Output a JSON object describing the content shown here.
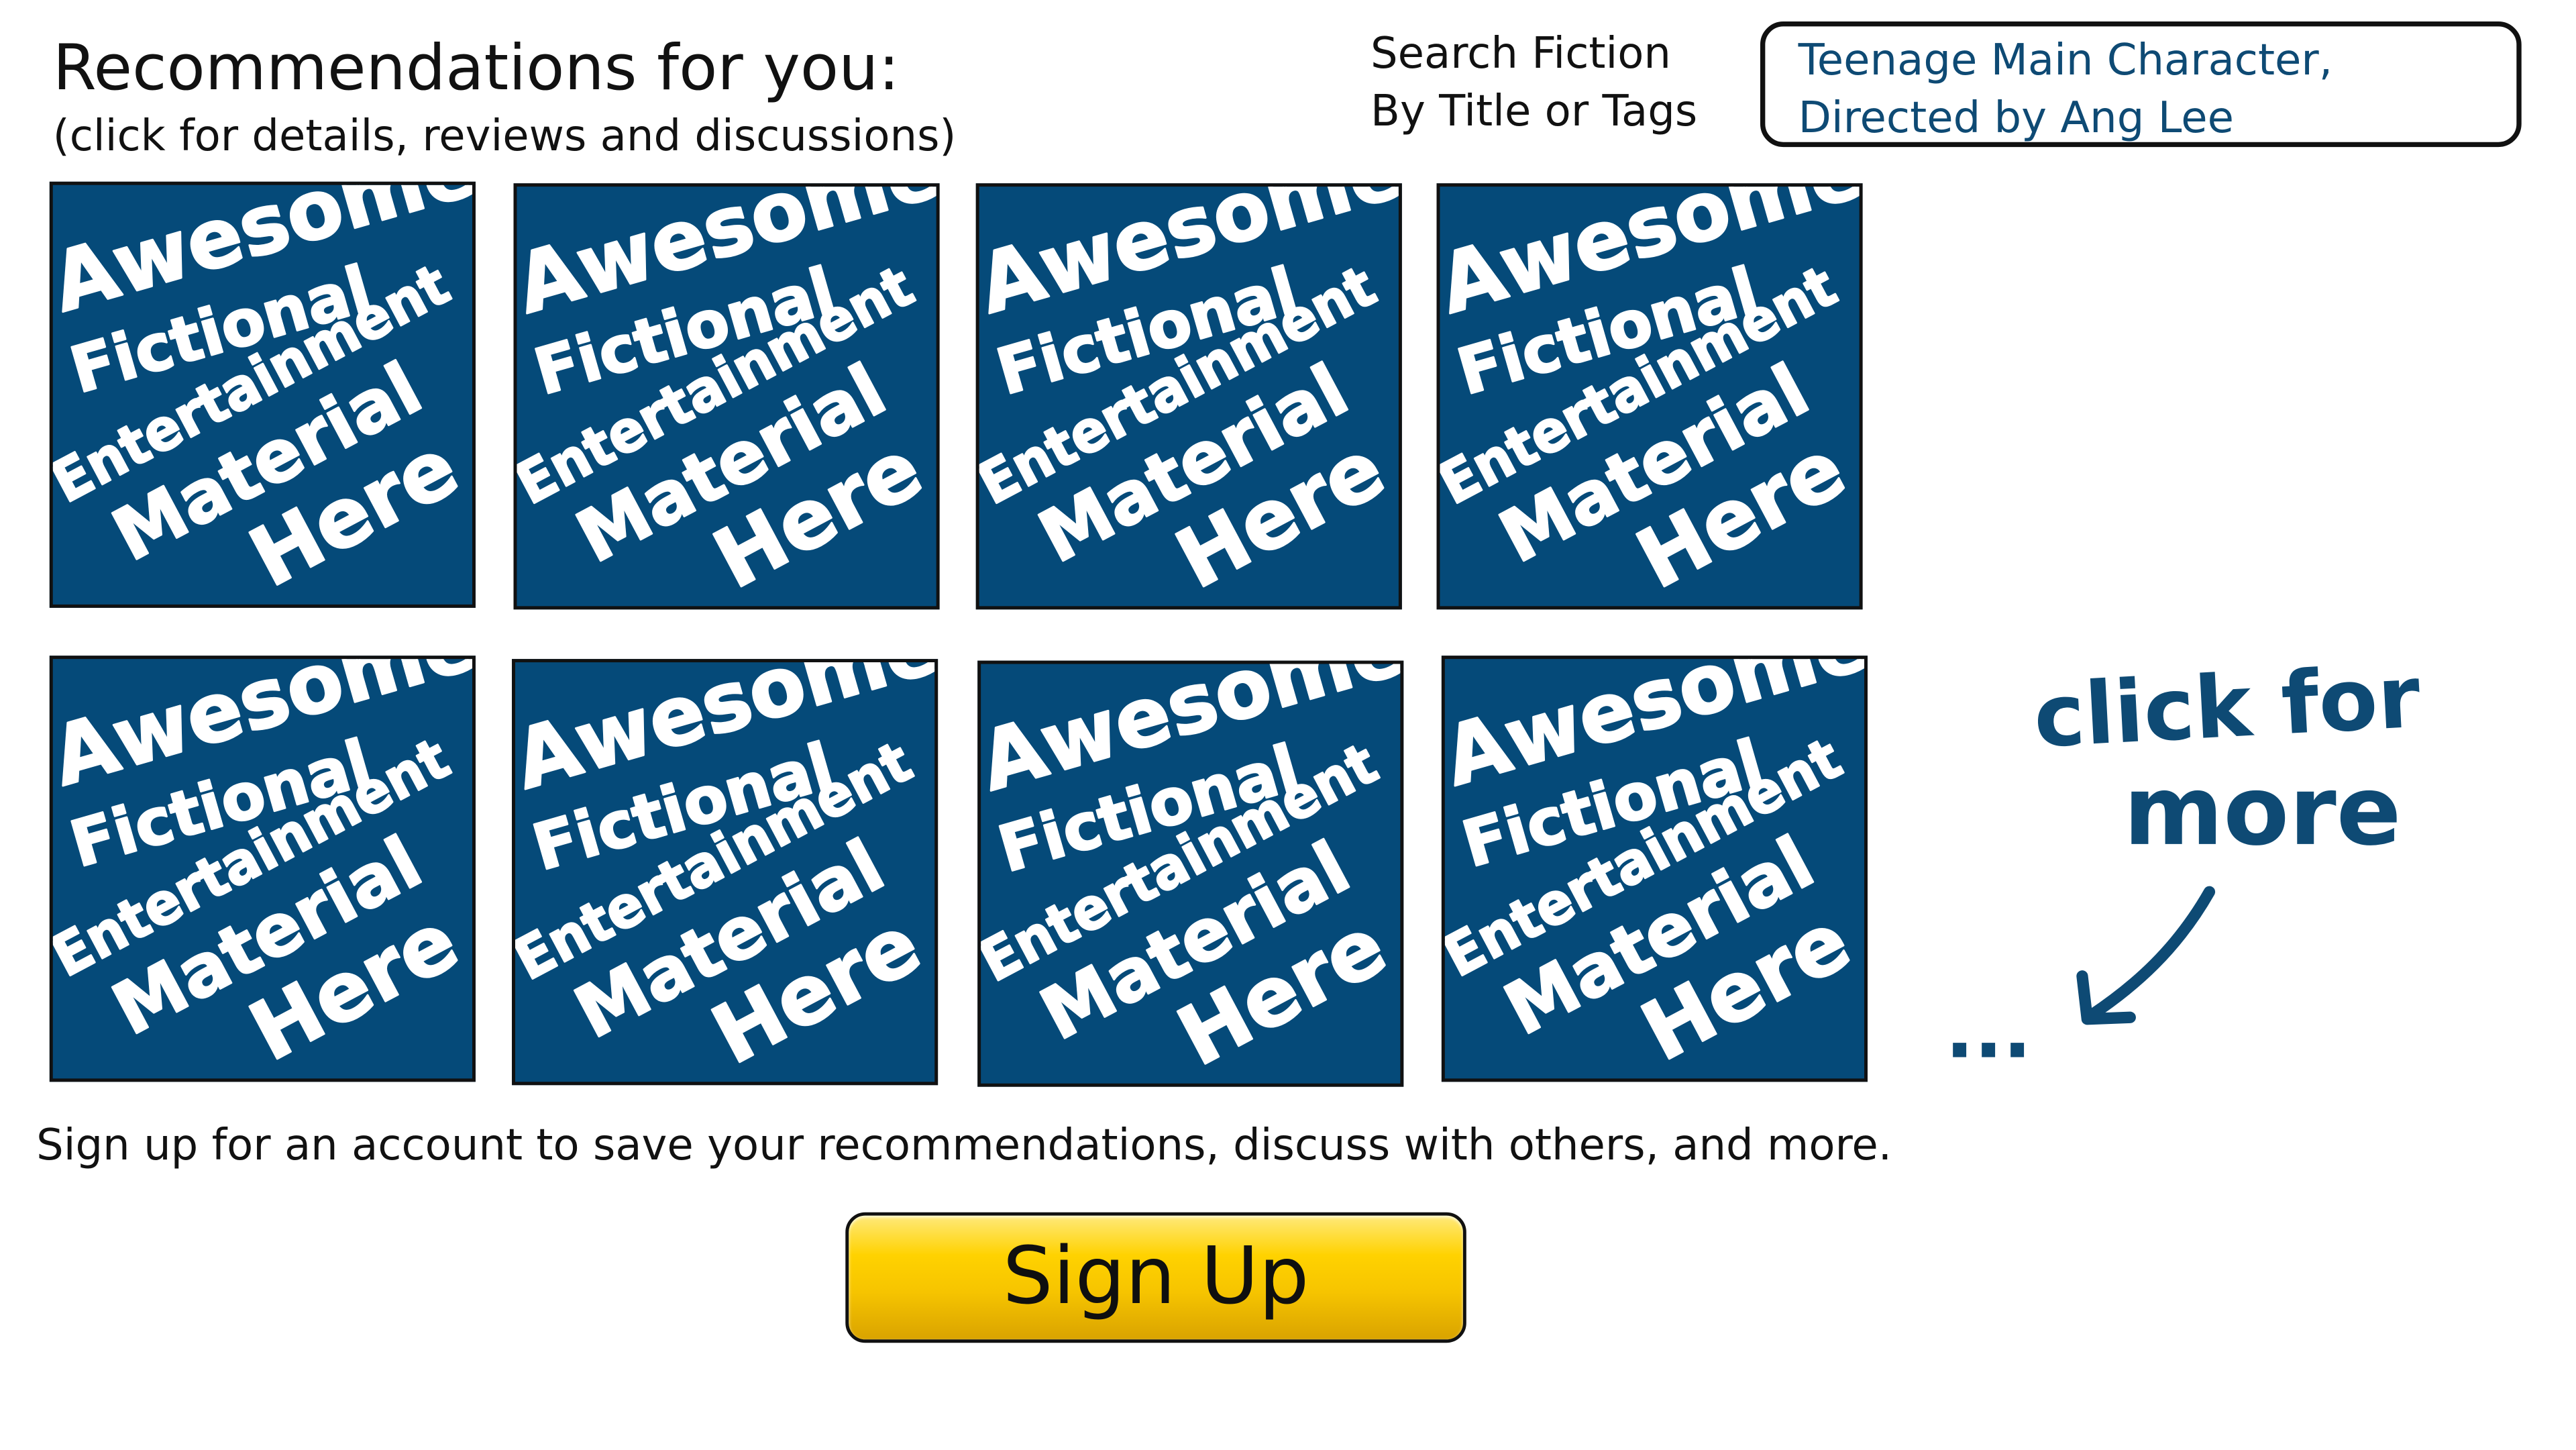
{
  "header": {
    "title": "Recommendations for you:",
    "subtitle": "(click for details, reviews and discussions)"
  },
  "search": {
    "label_line1": "Search Fiction",
    "label_line2": "By Title or Tags",
    "value_line1": "Teenage Main Character,",
    "value_line2": "Directed by Ang Lee"
  },
  "tile_text": {
    "line1": "Awesome",
    "line2": "Fictional",
    "line3": "Entertainment",
    "line4": "Material",
    "line5": "Here"
  },
  "more": {
    "line1": "click for",
    "line2": "more",
    "ellipsis": "..."
  },
  "signup": {
    "message": "Sign up for an account to save your recommendations, discuss with others, and more.",
    "button_label": "Sign Up"
  },
  "colors": {
    "tile_background": "#054a79",
    "accent_text": "#0e4a74",
    "button_gold": "#ffd200"
  }
}
